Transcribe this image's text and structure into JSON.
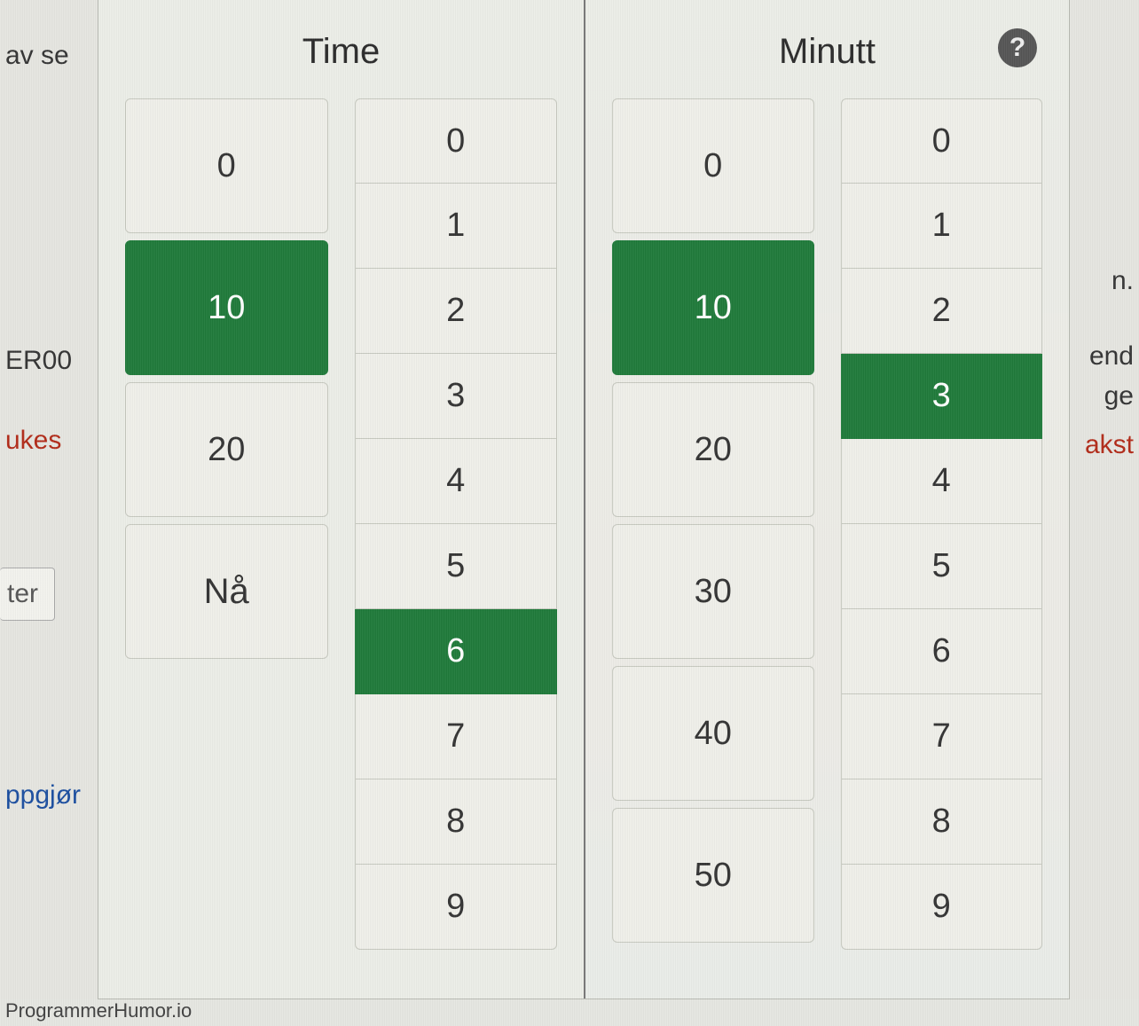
{
  "background": {
    "left": {
      "frag_top": "av se",
      "frag_code": "ER00",
      "frag_red": "ukes",
      "btn_label": "ter",
      "frag_link": "ppgjør"
    },
    "right": {
      "frag_n": "n.",
      "frag_end": "end",
      "frag_ge": "ge",
      "frag_red": "akst"
    }
  },
  "picker": {
    "hour": {
      "title": "Time",
      "tens": [
        "0",
        "10",
        "20"
      ],
      "tens_selected": 1,
      "now_label": "Nå",
      "units": [
        "0",
        "1",
        "2",
        "3",
        "4",
        "5",
        "6",
        "7",
        "8",
        "9"
      ],
      "units_selected": 6
    },
    "minute": {
      "title": "Minutt",
      "tens": [
        "0",
        "10",
        "20",
        "30",
        "40",
        "50"
      ],
      "tens_selected": 1,
      "units": [
        "0",
        "1",
        "2",
        "3",
        "4",
        "5",
        "6",
        "7",
        "8",
        "9"
      ],
      "units_selected": 3
    }
  },
  "watermark": "ProgrammerHumor.io",
  "colors": {
    "selected": "#1f7a3a"
  }
}
